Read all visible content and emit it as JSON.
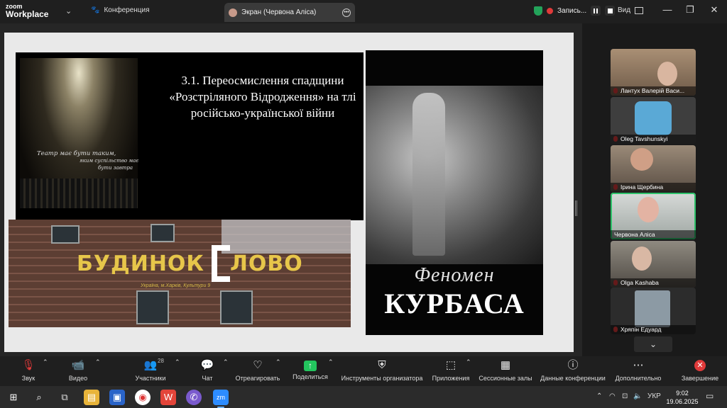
{
  "titlebar": {
    "brand_top": "zoom",
    "brand_bottom": "Workplace",
    "conference_label": "Конференция",
    "screen_tab_label": "Экран (Червона Аліса)",
    "recording_label": "Запись...",
    "view_label": "Вид",
    "window_controls": [
      "—",
      "❐",
      "✕"
    ]
  },
  "slide": {
    "quote_line1": "Театр має бути таким,",
    "quote_line2": "яким суспільство має",
    "quote_line3": "бути завтра",
    "title": "3.1. Переосмислення спадщини «Розстріляного Відродження» на тлі російсько-української війни",
    "budynok_left": "БУДИНОК",
    "budynok_right": "ЛОВО",
    "address": "Україна, м.Харків, Культури 9",
    "kurbas_top": "Феномен",
    "kurbas_bottom": "КУРБАСА"
  },
  "participants": [
    {
      "name": "Лантух Валерій Васи...",
      "muted": true
    },
    {
      "name": "Oleg Tavshunskyi",
      "muted": true
    },
    {
      "name": "Ірина Щербина",
      "muted": true
    },
    {
      "name": "Червона Аліса",
      "muted": false,
      "active": true
    },
    {
      "name": "Olga Kashaba",
      "muted": true
    },
    {
      "name": "Хряпін Едуард",
      "muted": true
    }
  ],
  "toolbar": {
    "sound": "Звук",
    "video": "Видео",
    "participants": "Участники",
    "participants_count": "28",
    "chat": "Чат",
    "react": "Отреагировать",
    "share": "Поделиться",
    "host_tools": "Инструменты организатора",
    "apps": "Приложения",
    "breakout": "Сессионные залы",
    "meeting_info": "Данные конференции",
    "more": "Дополнительно",
    "end": "Завершение"
  },
  "taskbar": {
    "lang": "УКР",
    "time": "9:02",
    "date": "19.06.2025"
  },
  "colors": {
    "accent_green": "#2ec26a",
    "record_red": "#e03a3a",
    "share_green": "#23c55e",
    "budynok_yellow": "#e7c64a"
  }
}
